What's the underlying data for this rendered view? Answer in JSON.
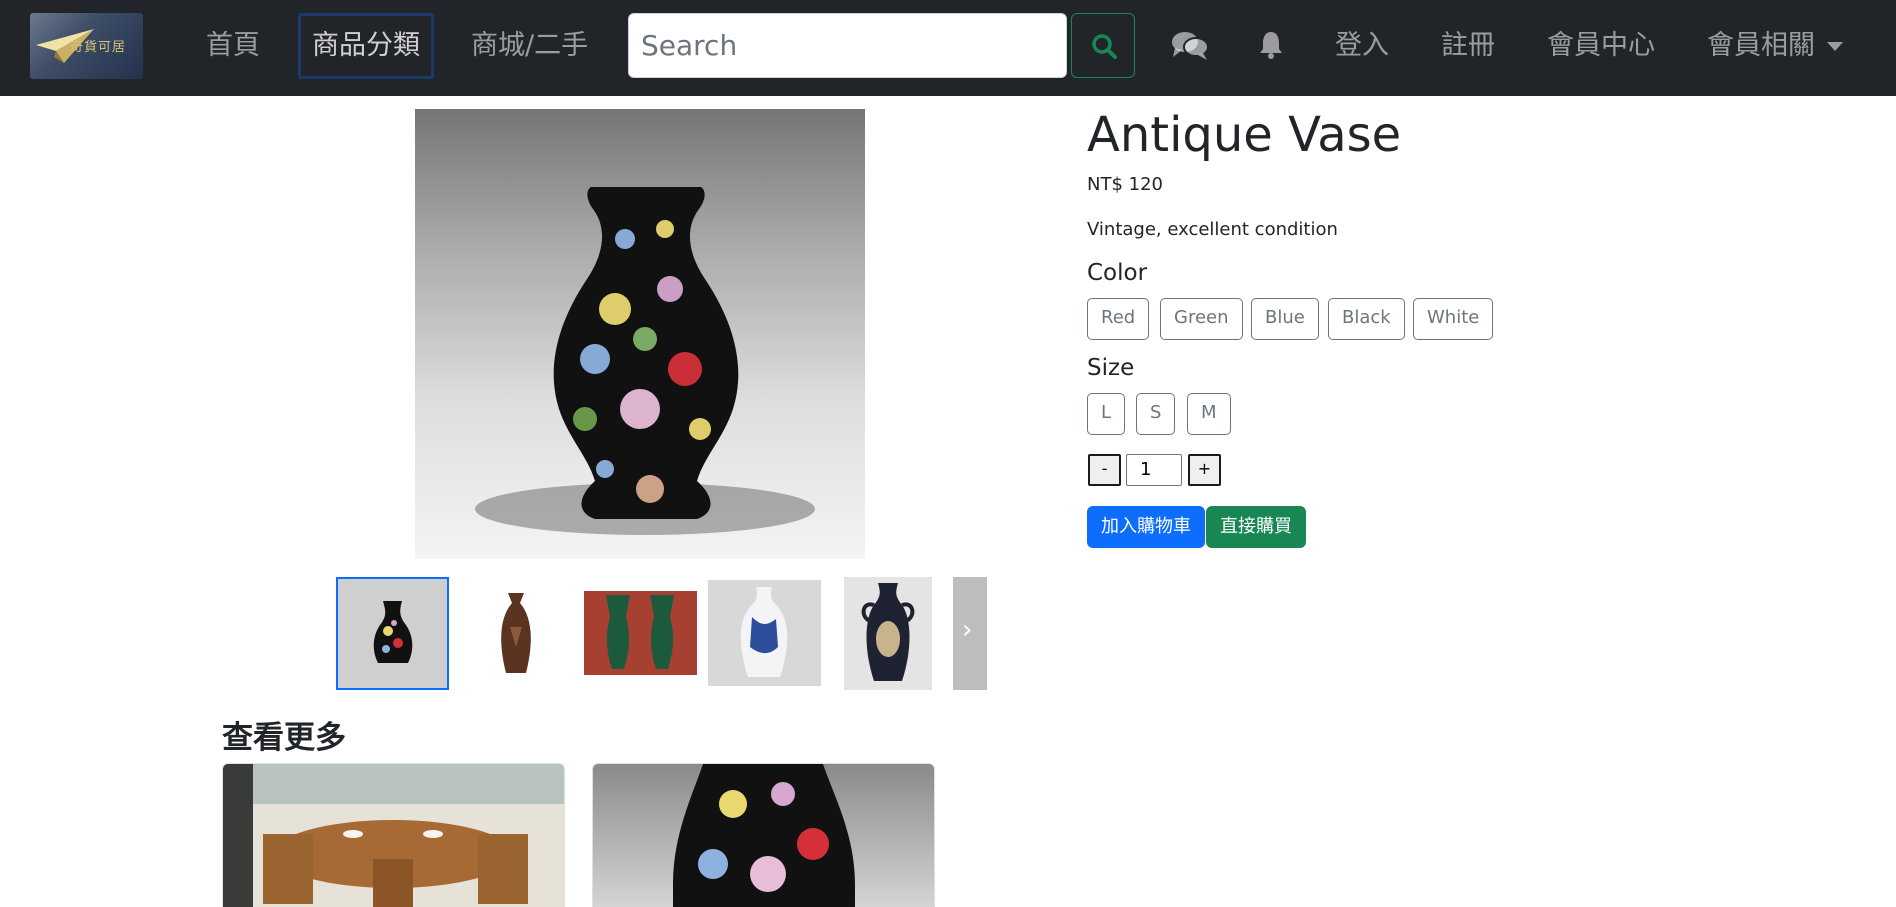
{
  "navbar": {
    "logo_text": "奇貨可居",
    "links": {
      "home": "首頁",
      "categories": "商品分類",
      "mall": "商城/二手",
      "login": "登入",
      "register": "註冊",
      "member_center": "會員中心",
      "member_related": "會員相關"
    },
    "search": {
      "placeholder": "Search",
      "value": ""
    },
    "icons": [
      "logo-icon",
      "search-icon",
      "chat-icon",
      "bell-icon",
      "chevron-down-icon"
    ]
  },
  "product": {
    "title": "Antique Vase",
    "price": "NT$ 120",
    "description": "Vintage, excellent condition",
    "color_label": "Color",
    "colors": [
      "Red",
      "Green",
      "Blue",
      "Black",
      "White"
    ],
    "size_label": "Size",
    "sizes": [
      "L",
      "S",
      "M"
    ],
    "quantity": {
      "minus": "-",
      "value": "1",
      "plus": "+"
    },
    "add_to_cart": "加入購物車",
    "buy_now": "直接購買",
    "thumbnails_selected_index": 0,
    "thumbnail_next_icon": "chevron-right-icon"
  },
  "more": {
    "title": "查看更多"
  },
  "colors": {
    "navbar_bg": "#212529",
    "primary": "#0d6efd",
    "success": "#198754",
    "thumb_selected_border": "#0d6efd"
  }
}
